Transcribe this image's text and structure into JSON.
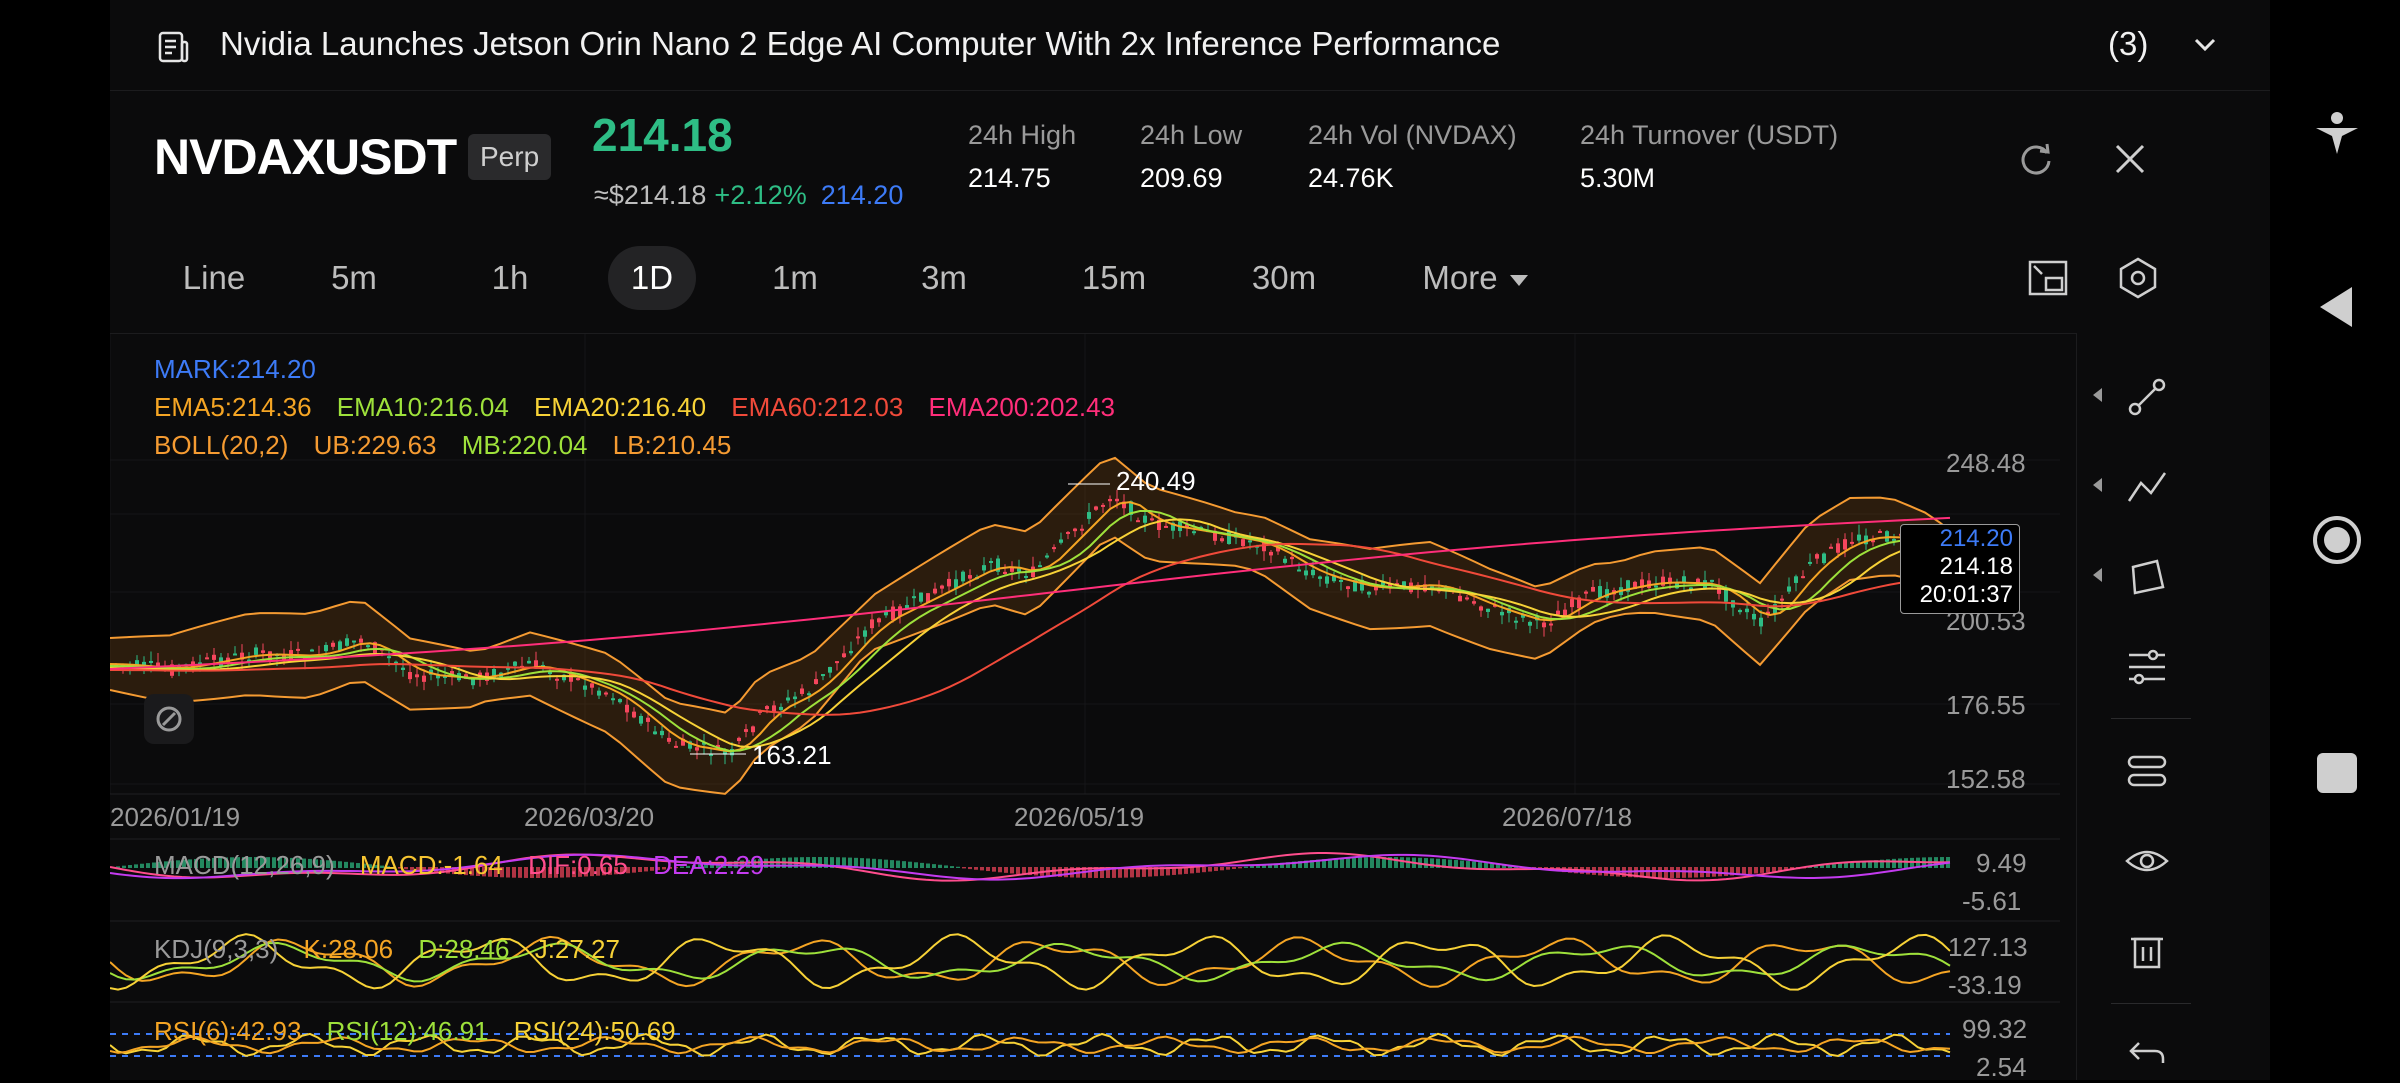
{
  "news": {
    "title": "Nvidia Launches Jetson Orin Nano 2 Edge AI Computer With 2x Inference Performance",
    "count": "(3)"
  },
  "ticker": {
    "symbol": "NVDAXUSDT",
    "tag": "Perp",
    "last_price": "214.18",
    "usd_approx": "≈$214.18",
    "change": "+2.12%",
    "mark": "214.20",
    "stats": [
      {
        "label": "24h  High",
        "value": "214.75"
      },
      {
        "label": "24h  Low",
        "value": "209.69"
      },
      {
        "label": "24h  Vol (NVDAX)",
        "value": "24.76K"
      },
      {
        "label": "24h  Turnover (USDT)",
        "value": "5.30M"
      }
    ]
  },
  "timeframes": [
    "Line",
    "5m",
    "1h",
    "1D",
    "1m",
    "3m",
    "15m",
    "30m"
  ],
  "active_timeframe": "1D",
  "more_label": "More",
  "legend": {
    "mark": "MARK:214.20",
    "ema": [
      "EMA5:214.36",
      "EMA10:216.04",
      "EMA20:216.40",
      "EMA60:212.03",
      "EMA200:202.43"
    ],
    "boll": [
      "BOLL(20,2)",
      "UB:229.63",
      "MB:220.04",
      "LB:210.45"
    ],
    "macd": [
      "MACD(12,26,9)",
      "MACD:-1.64",
      "DIF:0.65",
      "DEA:2.29"
    ],
    "kdj": [
      "KDJ(9,3,3)",
      "K:28.06",
      "D:28.46",
      "J:27.27"
    ],
    "rsi": [
      "RSI(6):42.93",
      "RSI(12):46.91",
      "RSI(24):50.69"
    ]
  },
  "price_axis": [
    "248.48",
    "200.53",
    "176.55",
    "152.58"
  ],
  "date_axis": [
    "2026/01/19",
    "2026/03/20",
    "2026/05/19",
    "2026/07/18"
  ],
  "annotations": {
    "high": "240.49",
    "low": "163.21"
  },
  "price_box": {
    "mark": "214.20",
    "last": "214.18",
    "countdown": "20:01:37"
  },
  "macd_axis": [
    "9.49",
    "-5.61"
  ],
  "kdj_axis": [
    "127.13",
    "-33.19"
  ],
  "rsi_axis": [
    "99.32",
    "2.54"
  ],
  "colors": {
    "up": "#2ebd85",
    "down": "#f6465d",
    "mark": "#3d7bf7",
    "ema5": "#f5a524",
    "ema10": "#9ee13b",
    "ema20": "#f7d237",
    "ema60": "#f04a3a",
    "ema200": "#ff2e7a",
    "boll": "#f59b32",
    "dif": "#ff4d8d",
    "dea": "#c43bf0"
  },
  "icons": {
    "side": [
      "line-tool-icon",
      "trend-tool-icon",
      "shape-tool-icon",
      "sliders-icon",
      "indicator-settings-icon",
      "eye-icon",
      "trash-icon",
      "undo-icon"
    ],
    "nav": [
      "accessibility-icon",
      "back-icon",
      "home-icon",
      "recents-icon"
    ]
  }
}
